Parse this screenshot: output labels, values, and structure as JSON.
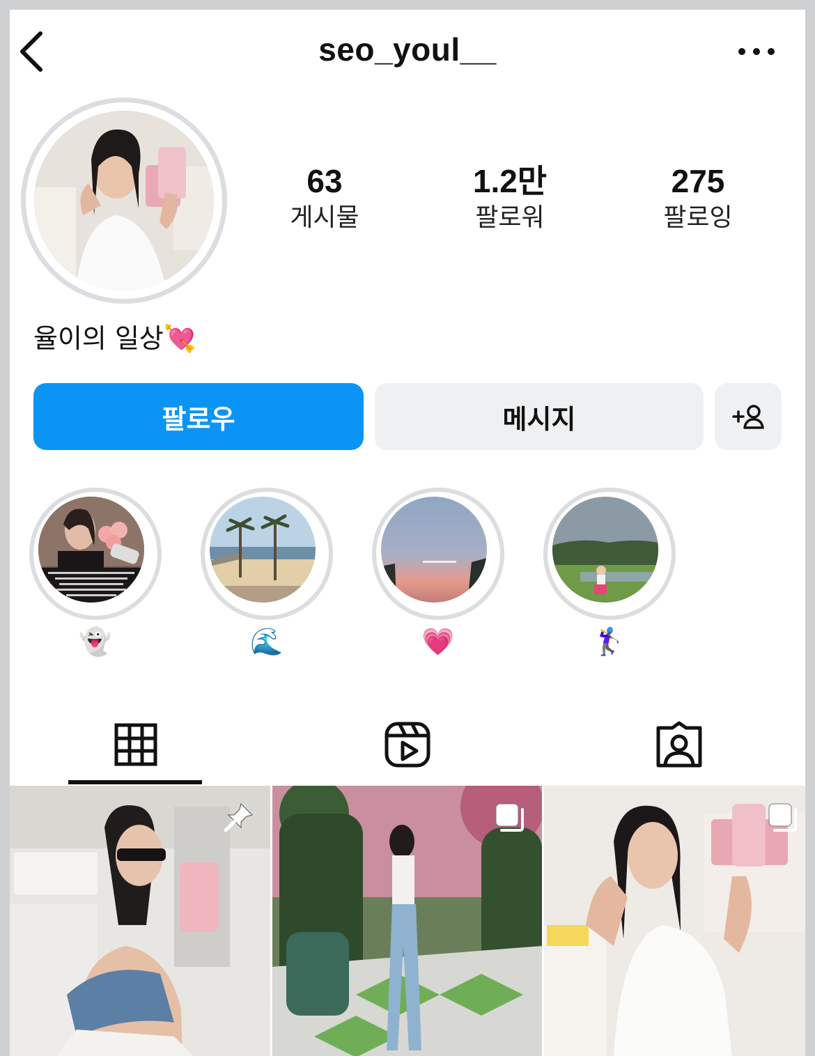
{
  "header": {
    "username": "seo_youl__",
    "back_icon": "chevron-left-icon",
    "more_icon": "more-horizontal-icon"
  },
  "profile": {
    "avatar": "profile-photo",
    "stats": [
      {
        "value": "63",
        "label": "게시물"
      },
      {
        "value": "1.2만",
        "label": "팔로워"
      },
      {
        "value": "275",
        "label": "팔로잉"
      }
    ],
    "bio": "율이의 일상💘"
  },
  "actions": {
    "follow_label": "팔로우",
    "message_label": "메시지",
    "add_user_icon": "add-user-icon"
  },
  "highlights": [
    {
      "label": "👻"
    },
    {
      "label": "🌊"
    },
    {
      "label": "💗"
    },
    {
      "label": "🏌️‍♀️"
    }
  ],
  "tabs": [
    {
      "name": "grid",
      "icon": "grid-icon",
      "active": true
    },
    {
      "name": "reels",
      "icon": "reels-icon",
      "active": false
    },
    {
      "name": "tagged",
      "icon": "tagged-person-icon",
      "active": false
    }
  ],
  "posts": [
    {
      "badge": "pin-icon"
    },
    {
      "badge": "multiple-photos-icon"
    },
    {
      "badge": "multiple-photos-icon"
    }
  ],
  "colors": {
    "follow_button": "#0a95f6",
    "secondary_button": "#eff0f2",
    "ring": "#dbdde1"
  }
}
